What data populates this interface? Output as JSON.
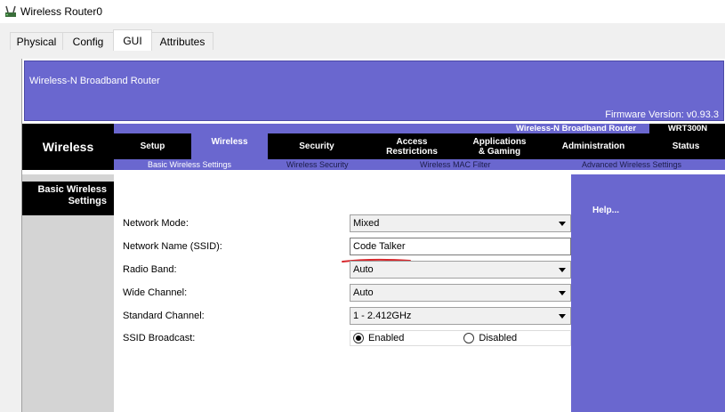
{
  "window": {
    "title": "Wireless Router0"
  },
  "tabs": [
    "Physical",
    "Config",
    "GUI",
    "Attributes"
  ],
  "header": {
    "router_name": "Wireless-N Broadband Router",
    "firmware": "Firmware Version: v0.93.3",
    "product_label": "Wireless-N Broadband Router",
    "model": "WRT300N",
    "section_title": "Wireless"
  },
  "main_tabs": [
    "Setup",
    "Wireless",
    "Security",
    "Access\nRestrictions",
    "Applications\n& Gaming",
    "Administration",
    "Status"
  ],
  "sub_tabs": [
    "Basic Wireless Settings",
    "Wireless Security",
    "Wireless MAC Filter",
    "Advanced Wireless Settings"
  ],
  "page": {
    "section_title": "Basic Wireless Settings",
    "help": "Help..."
  },
  "form": {
    "network_mode": {
      "label": "Network Mode:",
      "value": "Mixed"
    },
    "ssid": {
      "label": "Network Name (SSID):",
      "value": "Code Talker"
    },
    "radio_band": {
      "label": "Radio Band:",
      "value": "Auto"
    },
    "wide_channel": {
      "label": "Wide Channel:",
      "value": "Auto"
    },
    "standard_channel": {
      "label": "Standard Channel:",
      "value": "1 - 2.412GHz"
    },
    "ssid_broadcast": {
      "label": "SSID Broadcast:",
      "enabled_label": "Enabled",
      "disabled_label": "Disabled",
      "selected": "Enabled"
    }
  },
  "colors": {
    "accent": "#6a67cf",
    "nav": "#000000",
    "annotation": "#d7262b"
  }
}
